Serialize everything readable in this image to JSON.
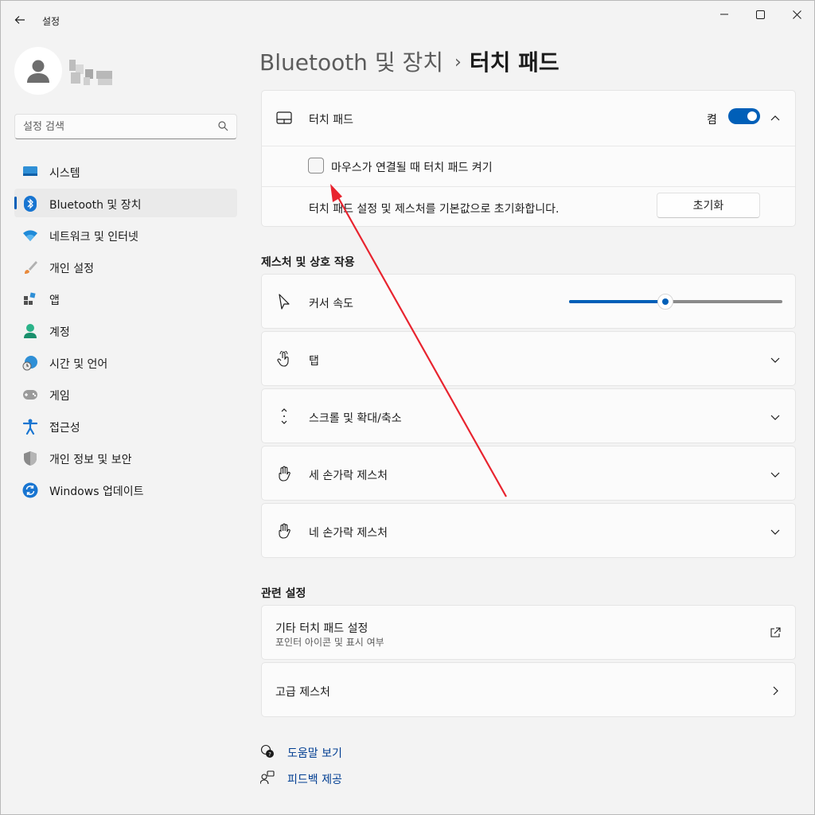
{
  "app": {
    "title": "설정"
  },
  "search": {
    "placeholder": "설정 검색"
  },
  "sidebar": {
    "items": [
      {
        "label": "시스템",
        "icon": "system-icon"
      },
      {
        "label": "Bluetooth 및 장치",
        "icon": "bluetooth-icon",
        "active": true
      },
      {
        "label": "네트워크 및 인터넷",
        "icon": "wifi-icon"
      },
      {
        "label": "개인 설정",
        "icon": "brush-icon"
      },
      {
        "label": "앱",
        "icon": "apps-icon"
      },
      {
        "label": "계정",
        "icon": "account-icon"
      },
      {
        "label": "시간 및 언어",
        "icon": "globe-clock-icon"
      },
      {
        "label": "게임",
        "icon": "gamepad-icon"
      },
      {
        "label": "접근성",
        "icon": "accessibility-icon"
      },
      {
        "label": "개인 정보 및 보안",
        "icon": "shield-icon"
      },
      {
        "label": "Windows 업데이트",
        "icon": "update-icon"
      }
    ]
  },
  "breadcrumb": {
    "parent": "Bluetooth 및 장치",
    "separator": "›",
    "current": "터치 패드"
  },
  "touchpad_card": {
    "label": "터치 패드",
    "toggle_state": "켬",
    "toggle_on": true,
    "checkbox_label": "마우스가 연결될 때 터치 패드 켜기",
    "checkbox_checked": false,
    "reset_text": "터치 패드 설정 및 제스처를 기본값으로 초기화합니다.",
    "reset_button": "초기화"
  },
  "gestures": {
    "title": "제스처 및 상호 작용",
    "cursor_speed": {
      "label": "커서 속도",
      "level_fraction": 0.45
    },
    "tap": "탭",
    "scroll_zoom": "스크롤 및 확대/축소",
    "three_finger": "세 손가락 제스처",
    "four_finger": "네 손가락 제스처"
  },
  "related": {
    "title": "관련 설정",
    "more_touchpad": {
      "label": "기타 터치 패드 설정",
      "sub": "포인터 아이콘 및 표시 여부"
    },
    "advanced_gestures": {
      "label": "고급 제스처"
    }
  },
  "footer": {
    "help": "도움말 보기",
    "feedback": "피드백 제공"
  },
  "colors": {
    "accent": "#005fb8",
    "background": "#f3f3f3",
    "card": "#fbfbfb",
    "annotation_arrow": "#e8242f"
  }
}
